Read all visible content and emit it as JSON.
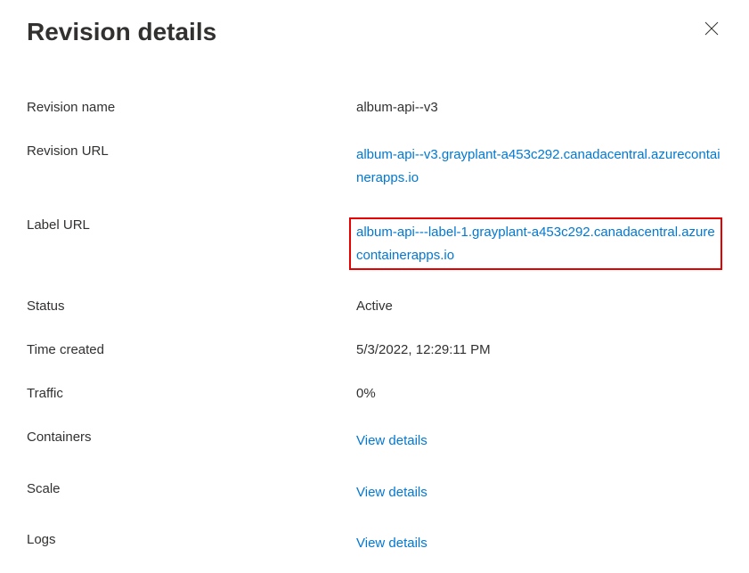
{
  "title": "Revision details",
  "fields": {
    "revision_name": {
      "label": "Revision name",
      "value": "album-api--v3"
    },
    "revision_url": {
      "label": "Revision URL",
      "value": "album-api--v3.grayplant-a453c292.canadacentral.azurecontainerapps.io"
    },
    "label_url": {
      "label": "Label URL",
      "value": "album-api---label-1.grayplant-a453c292.canadacentral.azurecontainerapps.io"
    },
    "status": {
      "label": "Status",
      "value": "Active"
    },
    "time_created": {
      "label": "Time created",
      "value": "5/3/2022, 12:29:11 PM"
    },
    "traffic": {
      "label": "Traffic",
      "value": "0%"
    },
    "containers": {
      "label": "Containers",
      "link_text": "View details"
    },
    "scale": {
      "label": "Scale",
      "link_text": "View details"
    },
    "logs": {
      "label": "Logs",
      "link_text": "View details"
    }
  }
}
